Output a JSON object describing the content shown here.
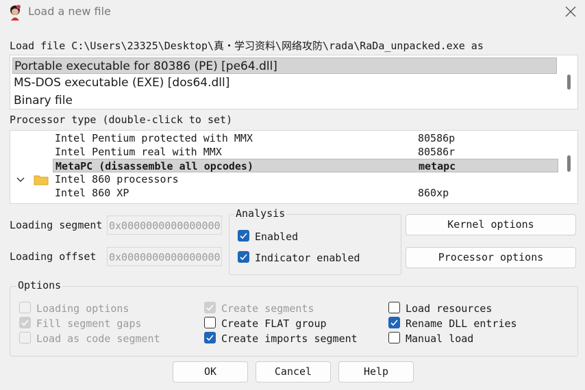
{
  "window": {
    "title": "Load a new file"
  },
  "load_file": {
    "label": "Load file C:\\Users\\23325\\Desktop\\真・学习资料\\网络攻防\\rada\\RaDa_unpacked.exe as"
  },
  "file_types": [
    {
      "label": "Portable executable for 80386 (PE) [pe64.dll]",
      "selected": true
    },
    {
      "label": "MS-DOS executable (EXE) [dos64.dll]",
      "selected": false
    },
    {
      "label": "Binary file",
      "selected": false
    }
  ],
  "processor": {
    "label": "Processor type (double-click to set)",
    "rows": [
      {
        "name": "Intel Pentium protected with MMX",
        "code": "80586p"
      },
      {
        "name": "Intel Pentium real with MMX",
        "code": "80586r"
      },
      {
        "name": "MetaPC (disassemble all opcodes)",
        "code": "metapc",
        "selected": true
      },
      {
        "name": "Intel 860 processors",
        "code": "",
        "folder": true
      },
      {
        "name": "Intel 860 XP",
        "code": "860xp"
      }
    ]
  },
  "loading_segment": {
    "label": "Loading segment",
    "value": "0x0000000000000000"
  },
  "loading_offset": {
    "label": "Loading offset",
    "value": "0x0000000000000000"
  },
  "analysis": {
    "title": "Analysis",
    "enabled": {
      "label": "Enabled",
      "checked": true
    },
    "indicator": {
      "label": "Indicator enabled",
      "checked": true
    }
  },
  "buttons": {
    "kernel": "Kernel options",
    "processor": "Processor options",
    "ok": "OK",
    "cancel": "Cancel",
    "help": "Help"
  },
  "options": {
    "title": "Options",
    "items": [
      {
        "label": "Loading options",
        "checked": false,
        "disabled": true
      },
      {
        "label": "Fill segment gaps",
        "checked": true,
        "disabled": true
      },
      {
        "label": "Load as code segment",
        "checked": false,
        "disabled": true
      },
      {
        "label": "Create segments",
        "checked": true,
        "disabled": true
      },
      {
        "label": "Create FLAT group",
        "checked": false,
        "disabled": false
      },
      {
        "label": "Create imports segment",
        "checked": true,
        "disabled": false
      },
      {
        "label": "Load resources",
        "checked": false,
        "disabled": false
      },
      {
        "label": "Rename DLL entries",
        "checked": true,
        "disabled": false
      },
      {
        "label": "Manual load",
        "checked": false,
        "disabled": false
      }
    ]
  },
  "colors": {
    "accent": "#1f66b8",
    "selection": "#d4d4d4",
    "background": "#f0f0f0"
  },
  "icons": {
    "app": "ida-lady-icon",
    "close": "close-icon",
    "folder": "folder-icon",
    "expand": "chevron-down-icon"
  }
}
